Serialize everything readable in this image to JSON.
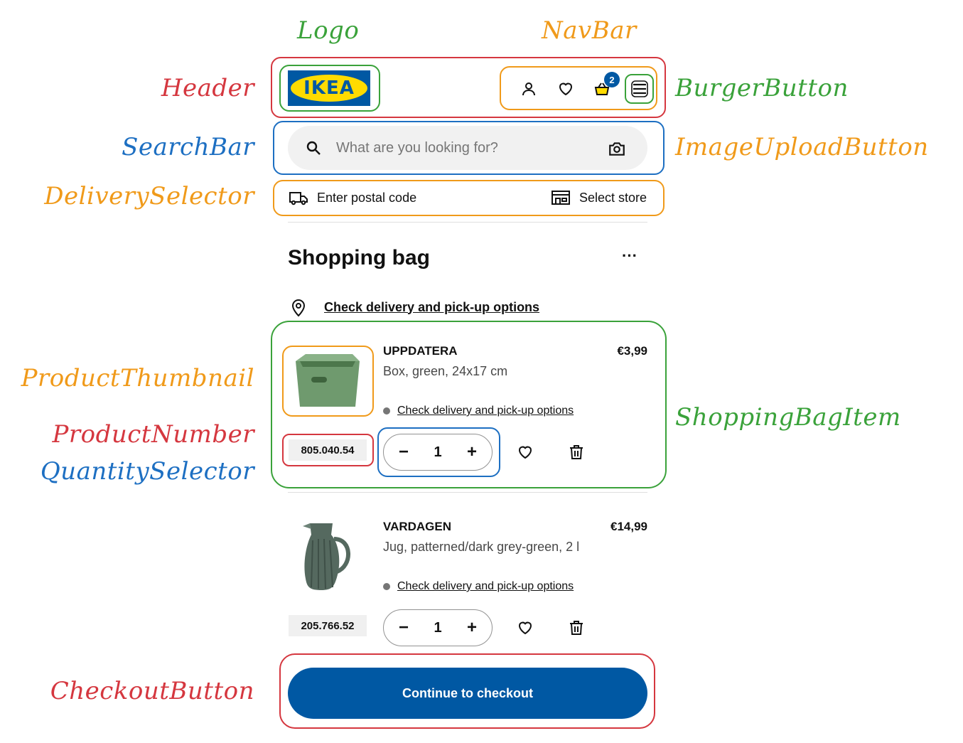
{
  "annotations": {
    "logo": "Logo",
    "navbar": "NavBar",
    "header": "Header",
    "burger_button": "BurgerButton",
    "search_bar": "SearchBar",
    "image_upload_button": "ImageUploadButton",
    "delivery_selector": "DeliverySelector",
    "product_thumbnail": "ProductThumbnail",
    "product_number": "ProductNumber",
    "quantity_selector": "QuantitySelector",
    "shopping_bag_item": "ShoppingBagItem",
    "checkout_button": "CheckoutButton"
  },
  "header": {
    "logo_text": "IKEA",
    "cart_count": "2"
  },
  "search": {
    "placeholder": "What are you looking for?"
  },
  "delivery": {
    "postal_label": "Enter postal code",
    "store_label": "Select store"
  },
  "bag": {
    "title": "Shopping bag",
    "more_label": "···",
    "check_delivery_label": "Check delivery and pick-up options",
    "items": [
      {
        "name": "UPPDATERA",
        "price": "€3,99",
        "description": "Box, green, 24x17 cm",
        "check_label": "Check delivery and pick-up options",
        "article_number": "805.040.54",
        "quantity": "1"
      },
      {
        "name": "VARDAGEN",
        "price": "€14,99",
        "description": "Jug, patterned/dark grey-green, 2 l",
        "check_label": "Check delivery and pick-up options",
        "article_number": "205.766.52",
        "quantity": "1"
      }
    ]
  },
  "qty_controls": {
    "minus": "−",
    "plus": "+"
  },
  "checkout": {
    "label": "Continue to checkout"
  },
  "colors": {
    "ikea_blue": "#0058a3",
    "ikea_yellow": "#ffdb00",
    "annotation_red": "#d5373f",
    "annotation_green": "#3aa23a",
    "annotation_orange": "#f09a1a",
    "annotation_blue": "#1d6fc2"
  }
}
